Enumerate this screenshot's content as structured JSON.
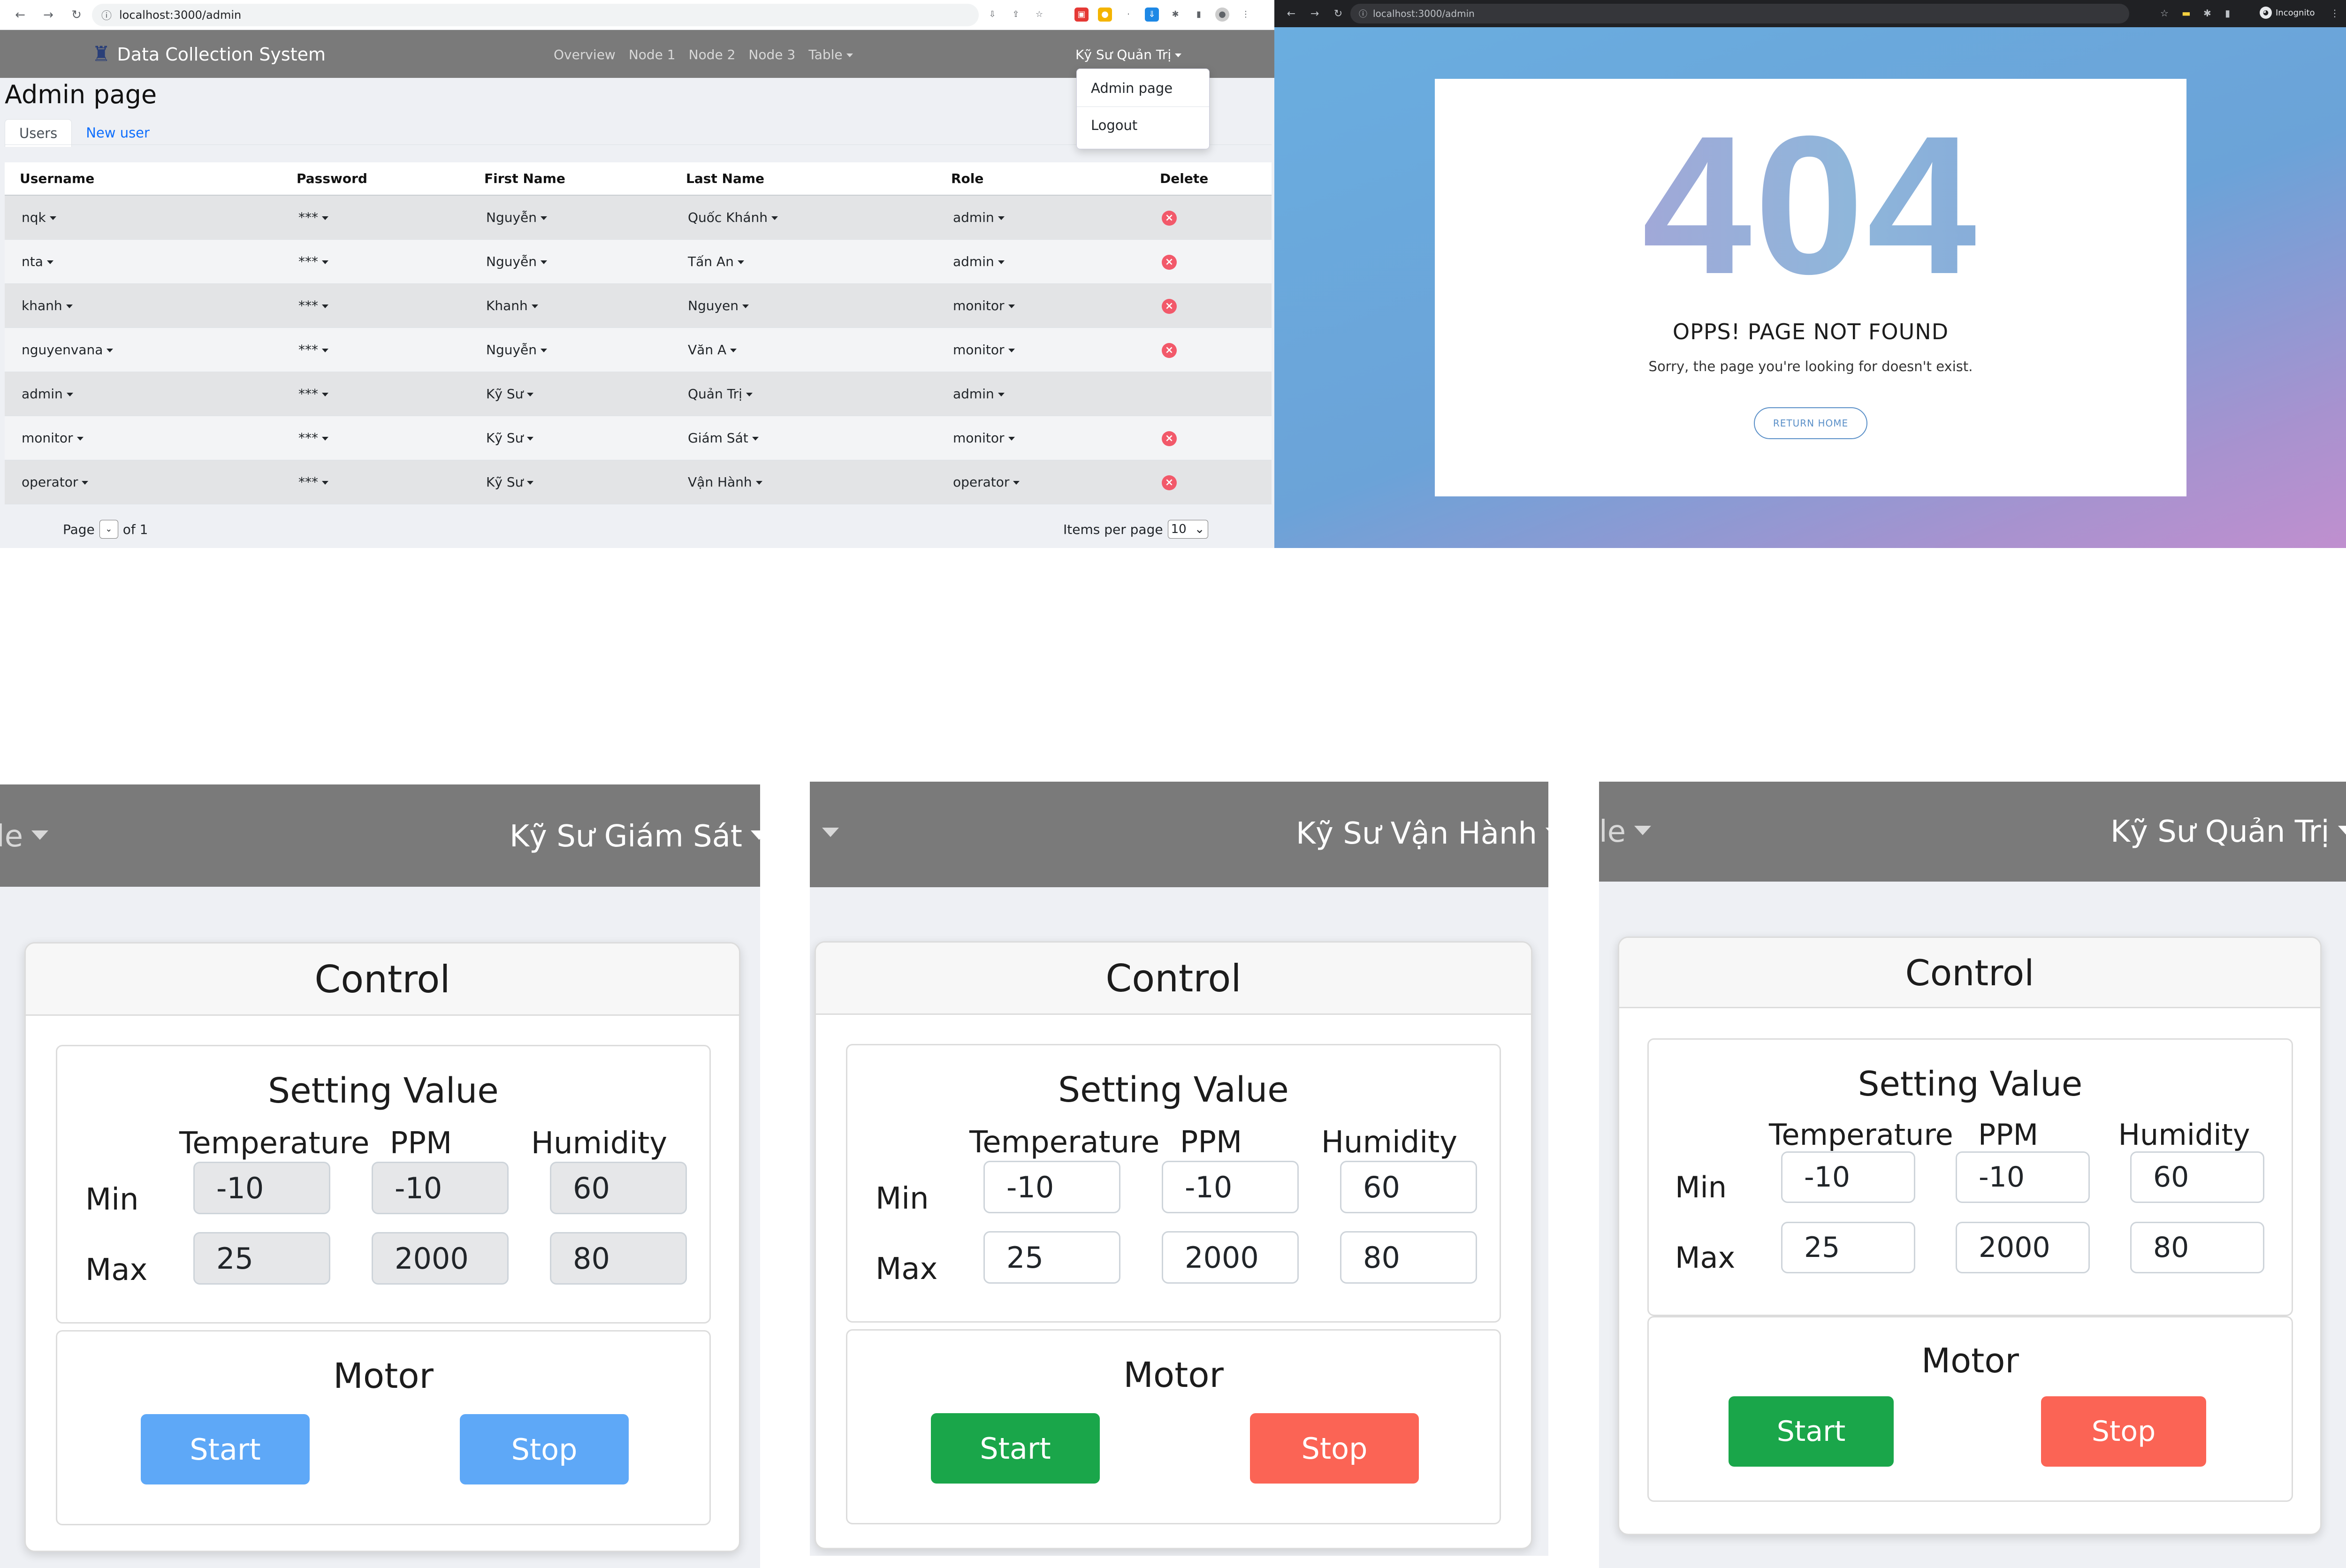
{
  "admin_screen": {
    "browser": {
      "url": "localhost:3000/admin"
    },
    "navbar": {
      "brand": "Data Collection System",
      "links": [
        "Overview",
        "Node 1",
        "Node 2",
        "Node 3",
        "Table"
      ],
      "user_menu": "Kỹ Sư Quản Trị",
      "dropdown": [
        "Admin page",
        "Logout"
      ]
    },
    "page_title": "Admin page",
    "tabs": [
      "Users",
      "New user"
    ],
    "table": {
      "headers": [
        "Username",
        "Password",
        "First Name",
        "Last Name",
        "Role",
        "Delete"
      ],
      "rows": [
        {
          "username": "nqk",
          "password": "***",
          "first_name": "Nguyễn",
          "last_name": "Quốc Khánh",
          "role": "admin",
          "deletable": true
        },
        {
          "username": "nta",
          "password": "***",
          "first_name": "Nguyễn",
          "last_name": "Tấn An",
          "role": "admin",
          "deletable": true
        },
        {
          "username": "khanh",
          "password": "***",
          "first_name": "Khanh",
          "last_name": "Nguyen",
          "role": "monitor",
          "deletable": true
        },
        {
          "username": "nguyenvana",
          "password": "***",
          "first_name": "Nguyễn",
          "last_name": "Văn A",
          "role": "monitor",
          "deletable": true
        },
        {
          "username": "admin",
          "password": "***",
          "first_name": "Kỹ Sư",
          "last_name": "Quản Trị",
          "role": "admin",
          "deletable": false
        },
        {
          "username": "monitor",
          "password": "***",
          "first_name": "Kỹ Sư",
          "last_name": "Giám Sát",
          "role": "monitor",
          "deletable": true
        },
        {
          "username": "operator",
          "password": "***",
          "first_name": "Kỹ Sư",
          "last_name": "Vận Hành",
          "role": "operator",
          "deletable": true
        }
      ]
    },
    "pagination": {
      "page_label": "Page",
      "of_label": "of 1",
      "items_per_page_label": "Items per page",
      "items_per_page_value": "10"
    }
  },
  "not_found_screen": {
    "browser": {
      "url": "localhost:3000/admin",
      "incognito_label": "Incognito"
    },
    "code": "404",
    "heading": "OPPS! PAGE NOT FOUND",
    "message": "Sorry, the page you're looking for doesn't exist.",
    "button": "RETURN HOME"
  },
  "control_panels": [
    {
      "nav_fragment": "le",
      "role": "Kỹ Sư Giám Sát",
      "card_title": "Control",
      "setting_title": "Setting Value",
      "columns": [
        "Temperature",
        "PPM",
        "Humidity"
      ],
      "rows": [
        {
          "label": "Min",
          "values": [
            "-10",
            "-10",
            "60"
          ]
        },
        {
          "label": "Max",
          "values": [
            "25",
            "2000",
            "80"
          ]
        }
      ],
      "inputs_disabled": true,
      "motor_title": "Motor",
      "start_label": "Start",
      "stop_label": "Stop",
      "start_color": "#5ea8f7",
      "stop_color": "#5ea8f7"
    },
    {
      "nav_fragment": "",
      "role": "Kỹ Sư Vận Hành",
      "card_title": "Control",
      "setting_title": "Setting Value",
      "columns": [
        "Temperature",
        "PPM",
        "Humidity"
      ],
      "rows": [
        {
          "label": "Min",
          "values": [
            "-10",
            "-10",
            "60"
          ]
        },
        {
          "label": "Max",
          "values": [
            "25",
            "2000",
            "80"
          ]
        }
      ],
      "inputs_disabled": false,
      "motor_title": "Motor",
      "start_label": "Start",
      "stop_label": "Stop",
      "start_color": "#1aa64a",
      "stop_color": "#fb6455"
    },
    {
      "nav_fragment": "le",
      "role": "Kỹ Sư Quản Trị",
      "card_title": "Control",
      "setting_title": "Setting Value",
      "columns": [
        "Temperature",
        "PPM",
        "Humidity"
      ],
      "rows": [
        {
          "label": "Min",
          "values": [
            "-10",
            "-10",
            "60"
          ]
        },
        {
          "label": "Max",
          "values": [
            "25",
            "2000",
            "80"
          ]
        }
      ],
      "inputs_disabled": false,
      "motor_title": "Motor",
      "start_label": "Start",
      "stop_label": "Stop",
      "start_color": "#1aa64a",
      "stop_color": "#fb6455"
    }
  ]
}
